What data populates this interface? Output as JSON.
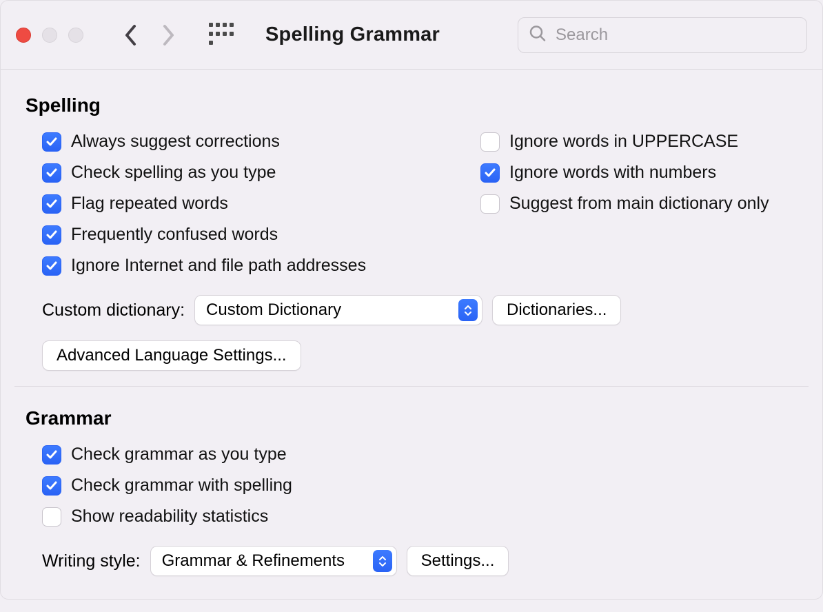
{
  "header": {
    "title": "Spelling  Grammar",
    "search_placeholder": "Search"
  },
  "spelling": {
    "title": "Spelling",
    "left": [
      {
        "label": "Always suggest corrections",
        "checked": true
      },
      {
        "label": "Check spelling as you type",
        "checked": true
      },
      {
        "label": "Flag repeated words",
        "checked": true
      },
      {
        "label": "Frequently confused words",
        "checked": true
      },
      {
        "label": "Ignore Internet and file path addresses",
        "checked": true
      }
    ],
    "right": [
      {
        "label": "Ignore words in UPPERCASE",
        "checked": false
      },
      {
        "label": "Ignore words with numbers",
        "checked": true
      },
      {
        "label": "Suggest from main dictionary only",
        "checked": false
      }
    ],
    "custom_dict_label": "Custom dictionary:",
    "custom_dict_value": "Custom Dictionary",
    "dictionaries_btn": "Dictionaries...",
    "advanced_btn": "Advanced Language Settings..."
  },
  "grammar": {
    "title": "Grammar",
    "options": [
      {
        "label": "Check grammar as you type",
        "checked": true
      },
      {
        "label": "Check grammar with spelling",
        "checked": true
      },
      {
        "label": "Show readability statistics",
        "checked": false
      }
    ],
    "writing_style_label": "Writing style:",
    "writing_style_value": "Grammar & Refinements",
    "settings_btn": "Settings..."
  }
}
